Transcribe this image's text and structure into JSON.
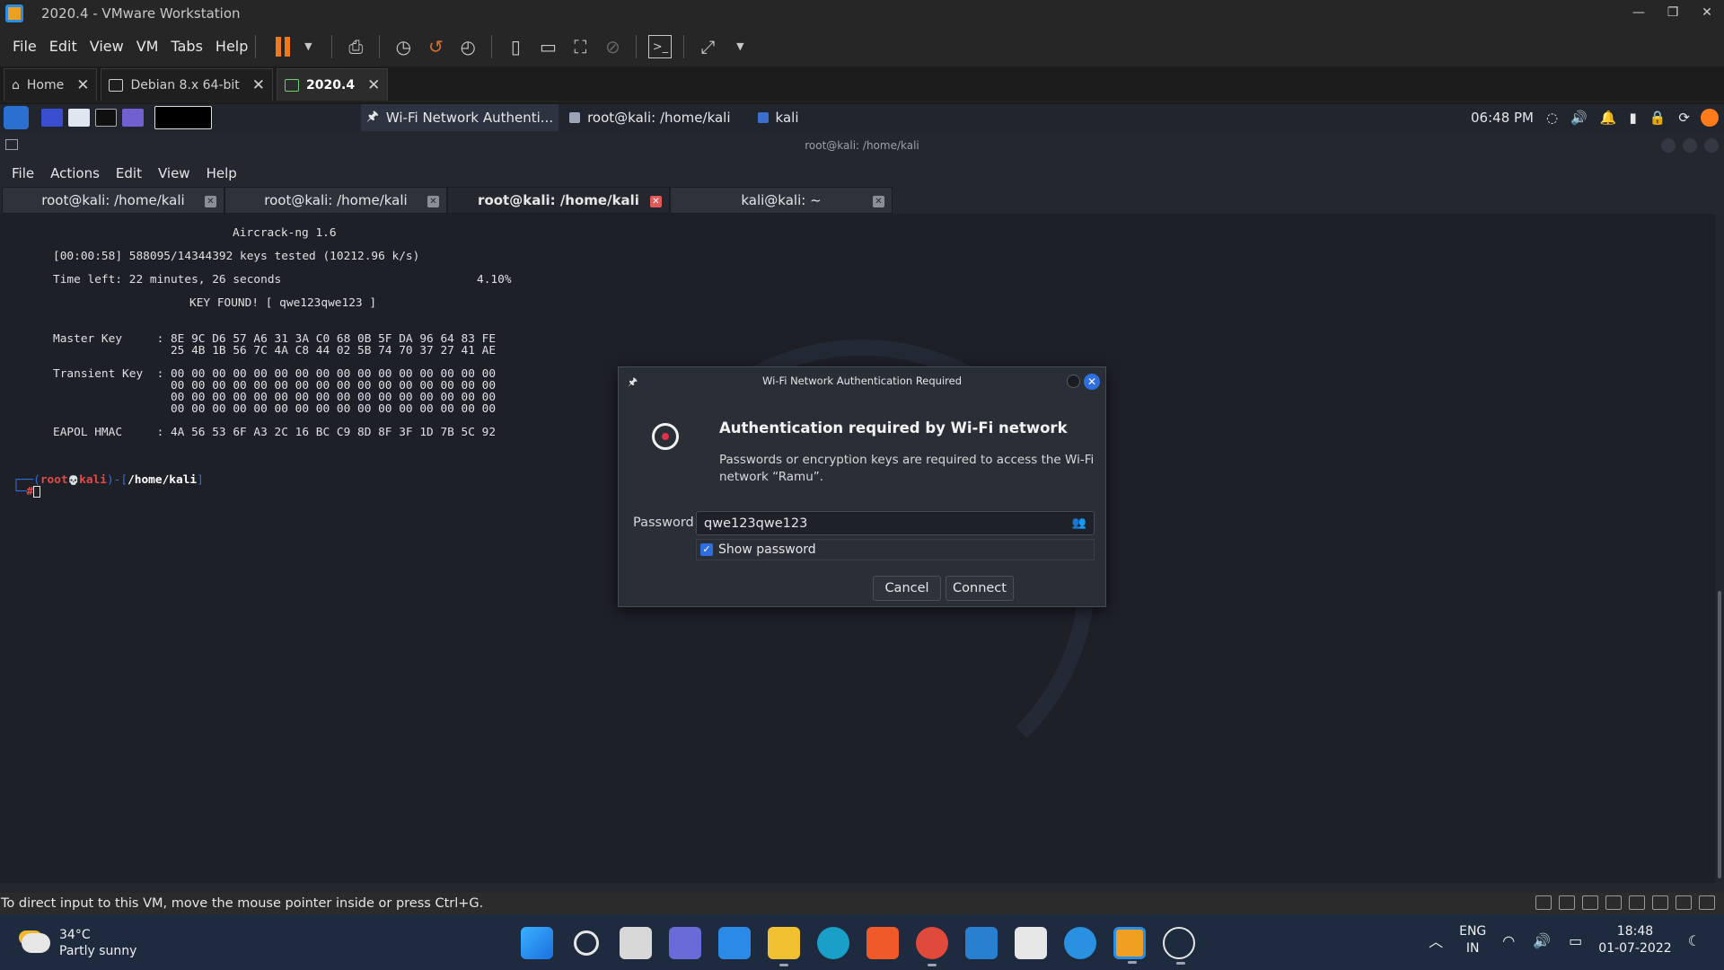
{
  "vmware": {
    "title": "2020.4 - VMware Workstation",
    "menu": [
      "File",
      "Edit",
      "View",
      "VM",
      "Tabs",
      "Help"
    ],
    "tabs": [
      {
        "label": "Home",
        "active": false
      },
      {
        "label": "Debian 8.x 64-bit",
        "active": false
      },
      {
        "label": "2020.4",
        "active": true
      }
    ],
    "status_text": "To direct input to this VM, move the mouse pointer inside or press Ctrl+G."
  },
  "kali_panel": {
    "tasks": [
      "Wi-Fi Network Authenti...",
      "root@kali: /home/kali",
      "kali"
    ],
    "time": "06:48 PM"
  },
  "terminal": {
    "window_title": "root@kali: /home/kali",
    "menu": [
      "File",
      "Actions",
      "Edit",
      "View",
      "Help"
    ],
    "tabs": [
      {
        "label": "root@kali: /home/kali",
        "active": false
      },
      {
        "label": "root@kali: /home/kali",
        "active": false
      },
      {
        "label": "root@kali: /home/kali",
        "active": true
      },
      {
        "label": "kali@kali: ~",
        "active": false
      }
    ],
    "lines": {
      "l1": "Aircrack-ng 1.6",
      "l2": "[00:00:58] 588095/14344392 keys tested (10212.96 k/s)",
      "l3a": "Time left: 22 minutes, 26 seconds",
      "l3b": "4.10%",
      "l4": "KEY FOUND! [ qwe123qwe123 ]",
      "l5": "Master Key     : 8E 9C D6 57 A6 31 3A C0 68 0B 5F DA 96 64 83 FE",
      "l6": "                 25 4B 1B 56 7C 4A C8 44 02 5B 74 70 37 27 41 AE",
      "l7": "Transient Key  : 00 00 00 00 00 00 00 00 00 00 00 00 00 00 00 00",
      "l8": "                 00 00 00 00 00 00 00 00 00 00 00 00 00 00 00 00",
      "l9": "                 00 00 00 00 00 00 00 00 00 00 00 00 00 00 00 00",
      "l10": "                 00 00 00 00 00 00 00 00 00 00 00 00 00 00 00 00",
      "l11": "EAPOL HMAC     : 4A 56 53 6F A3 2C 16 BC C9 8D 8F 3F 1D 7B 5C 92"
    },
    "prompt": {
      "open": "┌──(",
      "user": "root",
      "skull": "💀",
      "host": "kali",
      "mid": ")-[",
      "path": "/home/kali",
      "close": "]",
      "second": "└─",
      "hash": "#"
    }
  },
  "dialog": {
    "title": "Wi-Fi Network Authentication Required",
    "heading": "Authentication required by Wi-Fi network",
    "message": "Passwords or encryption keys are required to access the Wi-Fi network “Ramu”.",
    "password_label": "Password",
    "password_value": "qwe123qwe123",
    "show_password_label": "Show password",
    "show_password_checked": true,
    "cancel_label": "Cancel",
    "connect_label": "Connect"
  },
  "windows_taskbar": {
    "temperature": "34°C",
    "weather": "Partly sunny",
    "lang1": "ENG",
    "lang2": "IN",
    "time": "18:48",
    "date": "01-07-2022"
  },
  "colors": {
    "accent_blue": "#2e6fe0",
    "vmware_pause": "#f07a1a",
    "prompt_red": "#e04a4a"
  }
}
